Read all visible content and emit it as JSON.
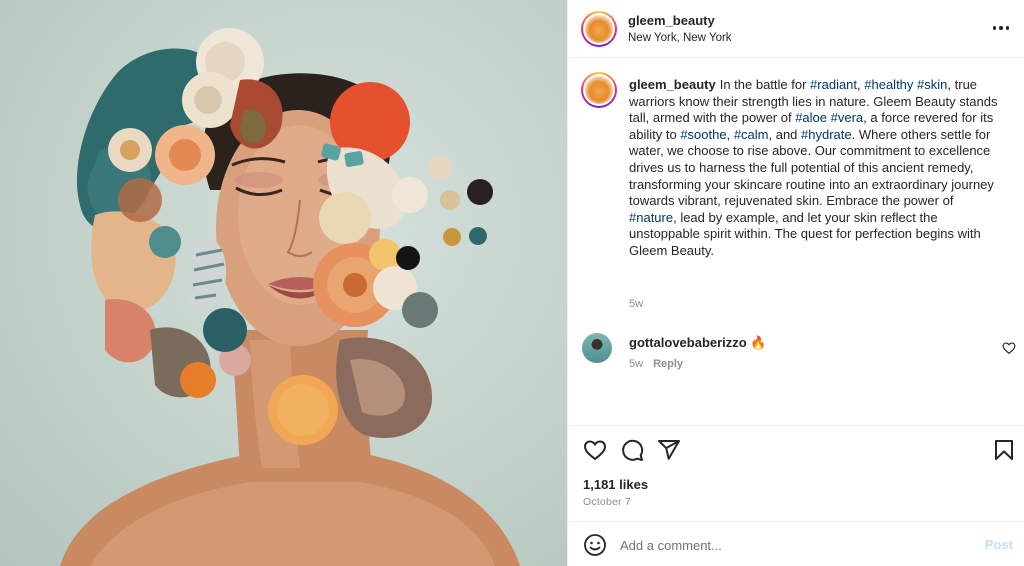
{
  "post": {
    "username": "gleem_beauty",
    "location": "New York, New York"
  },
  "caption": {
    "username": "gleem_beauty",
    "segments": [
      {
        "text": "In the battle for ",
        "tag": false
      },
      {
        "text": "#radiant",
        "tag": true
      },
      {
        "text": ", ",
        "tag": false
      },
      {
        "text": "#healthy",
        "tag": true
      },
      {
        "text": " ",
        "tag": false
      },
      {
        "text": "#skin",
        "tag": true
      },
      {
        "text": ", true warriors know their strength lies in nature. Gleem Beauty stands tall, armed with the power of ",
        "tag": false
      },
      {
        "text": "#aloe",
        "tag": true
      },
      {
        "text": " ",
        "tag": false
      },
      {
        "text": "#vera",
        "tag": true
      },
      {
        "text": ", a force revered for its ability to ",
        "tag": false
      },
      {
        "text": "#soothe",
        "tag": true
      },
      {
        "text": ", ",
        "tag": false
      },
      {
        "text": "#calm",
        "tag": true
      },
      {
        "text": ", and ",
        "tag": false
      },
      {
        "text": "#hydrate",
        "tag": true
      },
      {
        "text": ". Where others settle for water, we choose to rise above. Our commitment to excellence drives us to harness the full potential of this ancient remedy, transforming your skincare routine into an extraordinary journey towards vibrant, rejuvenated skin. Embrace the power of ",
        "tag": false
      },
      {
        "text": "#nature",
        "tag": true
      },
      {
        "text": ", lead by example, and let your skin reflect the unstoppable spirit within. The quest for perfection begins with Gleem Beauty.",
        "tag": false
      }
    ],
    "time": "5w"
  },
  "comment": {
    "username": "gottalovebaberizzo 🔥",
    "time": "5w",
    "reply_label": "Reply"
  },
  "actions": {
    "likes": "1,181 likes",
    "date": "October 7"
  },
  "add_comment": {
    "placeholder": "Add a comment...",
    "post_label": "Post"
  },
  "icons": {
    "more": "more-horizontal-icon",
    "like": "heart-icon",
    "comment": "comment-icon",
    "share": "send-icon",
    "save": "bookmark-icon",
    "emoji": "emoji-icon",
    "comment_like": "heart-icon"
  },
  "colors": {
    "hashtag": "#00376b",
    "post_button_disabled": "#c0dffd",
    "muted_text": "#8e8e8e"
  }
}
